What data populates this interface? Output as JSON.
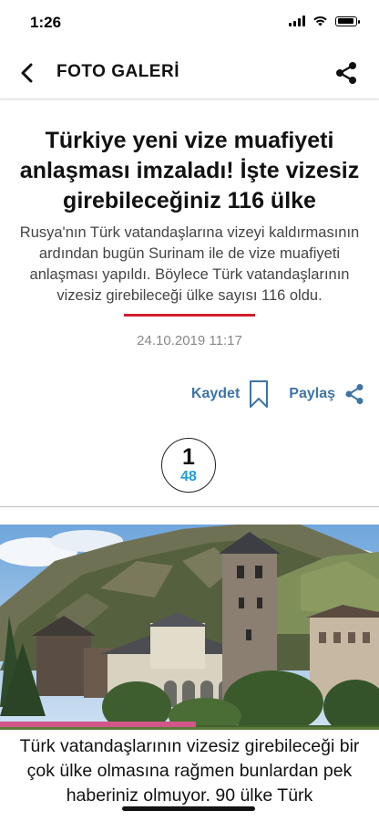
{
  "status_bar": {
    "time": "1:26"
  },
  "nav": {
    "title": "FOTO GALERİ",
    "back_icon": "chevron-left-icon",
    "share_icon": "share-icon"
  },
  "article": {
    "headline": "Türkiye yeni vize muafiyeti anlaşması imzaladı! İşte vizesiz girebileceğiniz 116 ülke",
    "summary": "Rusya'nın Türk vatandaşlarına vizeyi kaldırmasının ardından bugün Surinam ile de vize muafiyeti anlaşması yapıldı. Böylece Türk vatandaşlarının vizesiz girebileceği ülke sayısı 116 oldu.",
    "date": "24.10.2019 11:17",
    "accent_color": "#d0202e"
  },
  "actions": {
    "save_label": "Kaydet",
    "share_label": "Paylaş",
    "color": "#3d74a5"
  },
  "gallery": {
    "current": "1",
    "total": "48",
    "total_color": "#1e9fd8"
  },
  "caption": "Türk vatandaşlarının vizesiz girebileceği bir çok ülke olmasına rağmen bunlardan pek haberiniz olmuyor. 90 ülke Türk"
}
